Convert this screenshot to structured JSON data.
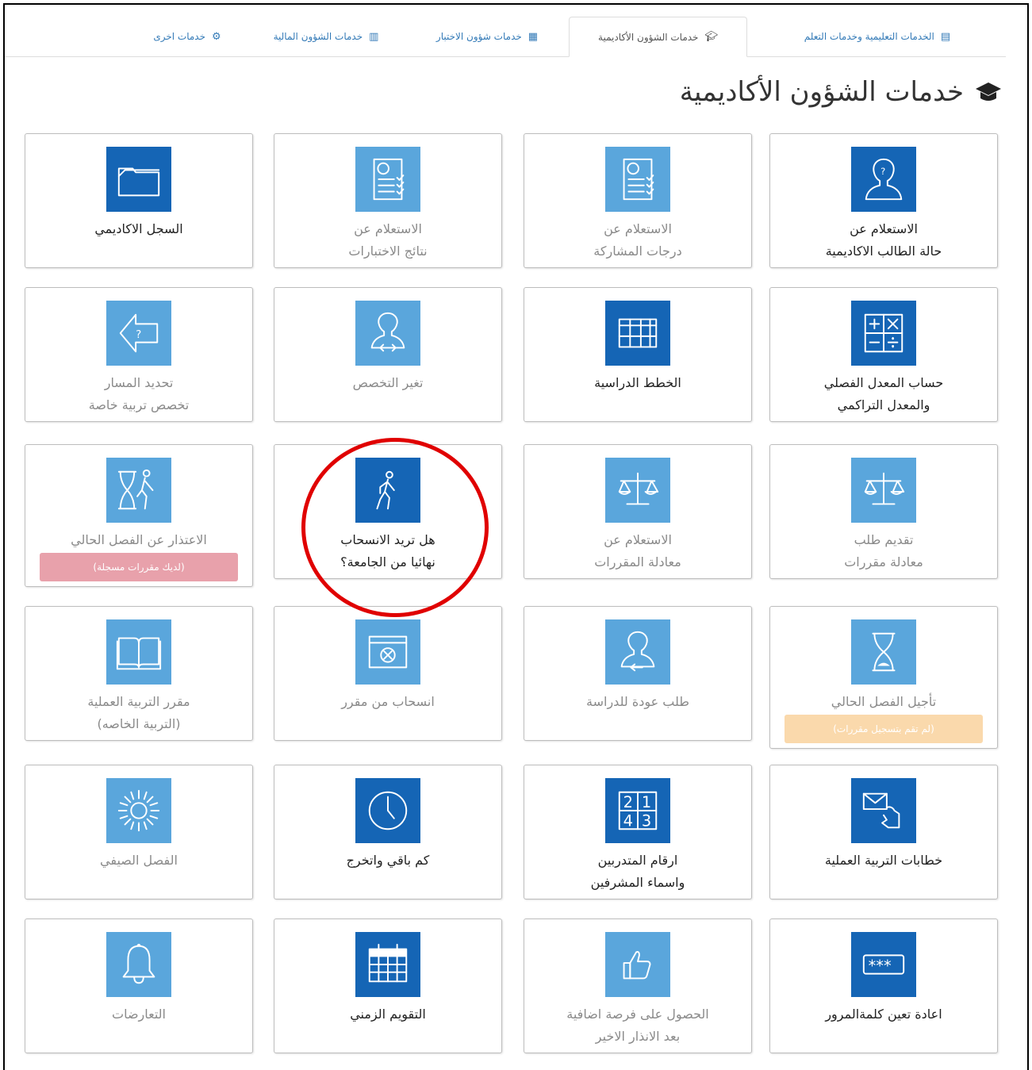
{
  "tabs": [
    {
      "label": "الخدمات التعليمية وخدمات التعلم",
      "icon": "document-list-icon",
      "active": false
    },
    {
      "label": "خدمات الشؤون الأكاديمية",
      "icon": "graduation-cap-icon",
      "active": true
    },
    {
      "label": "خدمات شؤون الاختبار",
      "icon": "calculator-icon",
      "active": false
    },
    {
      "label": "خدمات الشؤون المالية",
      "icon": "money-icon",
      "active": false
    },
    {
      "label": "خدمات اخرى",
      "icon": "gear-icon",
      "active": false
    }
  ],
  "page_title": "خدمات الشؤون الأكاديمية",
  "cards": [
    {
      "label": "الاستعلام عن\nحالة الطالب الاكاديمية",
      "icon": "student-head-icon",
      "enabled": true
    },
    {
      "label": "الاستعلام عن\nدرجات المشاركة",
      "icon": "exam-sheet-icon",
      "enabled": false
    },
    {
      "label": "الاستعلام عن\nنتائج الاختبارات",
      "icon": "exam-sheet-icon",
      "enabled": false
    },
    {
      "label": "السجل الاكاديمي",
      "icon": "folder-icon",
      "enabled": true
    },
    {
      "label": "حساب المعدل الفصلي\nوالمعدل التراكمي",
      "icon": "calculator-icon",
      "enabled": true
    },
    {
      "label": "الخطط الدراسية",
      "icon": "table-grid-icon",
      "enabled": true
    },
    {
      "label": "تغير التخصص",
      "icon": "person-arrows-icon",
      "enabled": false
    },
    {
      "label": "تحديد المسار\nتخصص تربية خاصة",
      "icon": "direction-arrow-icon",
      "enabled": false
    },
    {
      "label": "تقديم طلب\nمعادلة مقررات",
      "icon": "scales-icon",
      "enabled": false
    },
    {
      "label": "الاستعلام عن\nمعادلة المقررات",
      "icon": "scales-icon",
      "enabled": false
    },
    {
      "label": "هل تريد الانسحاب\nنهائيا من الجامعة؟",
      "icon": "walking-person-icon",
      "enabled": true
    },
    {
      "label": "الاعتذار عن الفصل الحالي",
      "icon": "hourglass-person-icon",
      "enabled": false,
      "badge": "(لديك مقررات مسجلة)",
      "badge_color": "#e8a1ab"
    },
    {
      "label": "تأجيل الفصل الحالي",
      "icon": "hourglass-icon",
      "enabled": false,
      "badge": "(لم تقم بتسجيل مقررات)",
      "badge_color": "#fad9ac"
    },
    {
      "label": "طلب عودة للدراسة",
      "icon": "person-back-icon",
      "enabled": false
    },
    {
      "label": "انسحاب من مقرر",
      "icon": "cancel-window-icon",
      "enabled": false
    },
    {
      "label": "مقرر التربية العملية\n(التربية الخاصه)",
      "icon": "open-book-icon",
      "enabled": false
    },
    {
      "label": "خطابات التربية العملية",
      "icon": "envelope-hand-icon",
      "enabled": true
    },
    {
      "label": "ارقام المتدربين\nواسماء المشرفين",
      "icon": "numbers-grid-icon",
      "enabled": true
    },
    {
      "label": "كم باقي واتخرج",
      "icon": "clock-icon",
      "enabled": true
    },
    {
      "label": "الفصل الصيفي",
      "icon": "sun-icon",
      "enabled": false
    },
    {
      "label": "اعادة تعين كلمةالمرور",
      "icon": "password-icon",
      "enabled": true
    },
    {
      "label": "الحصول على فرصة اضافية\nبعد الانذار الاخير",
      "icon": "thumbs-up-icon",
      "enabled": false
    },
    {
      "label": "التقويم الزمني",
      "icon": "calendar-icon",
      "enabled": true
    },
    {
      "label": "التعارضات",
      "icon": "bell-icon",
      "enabled": false
    }
  ]
}
